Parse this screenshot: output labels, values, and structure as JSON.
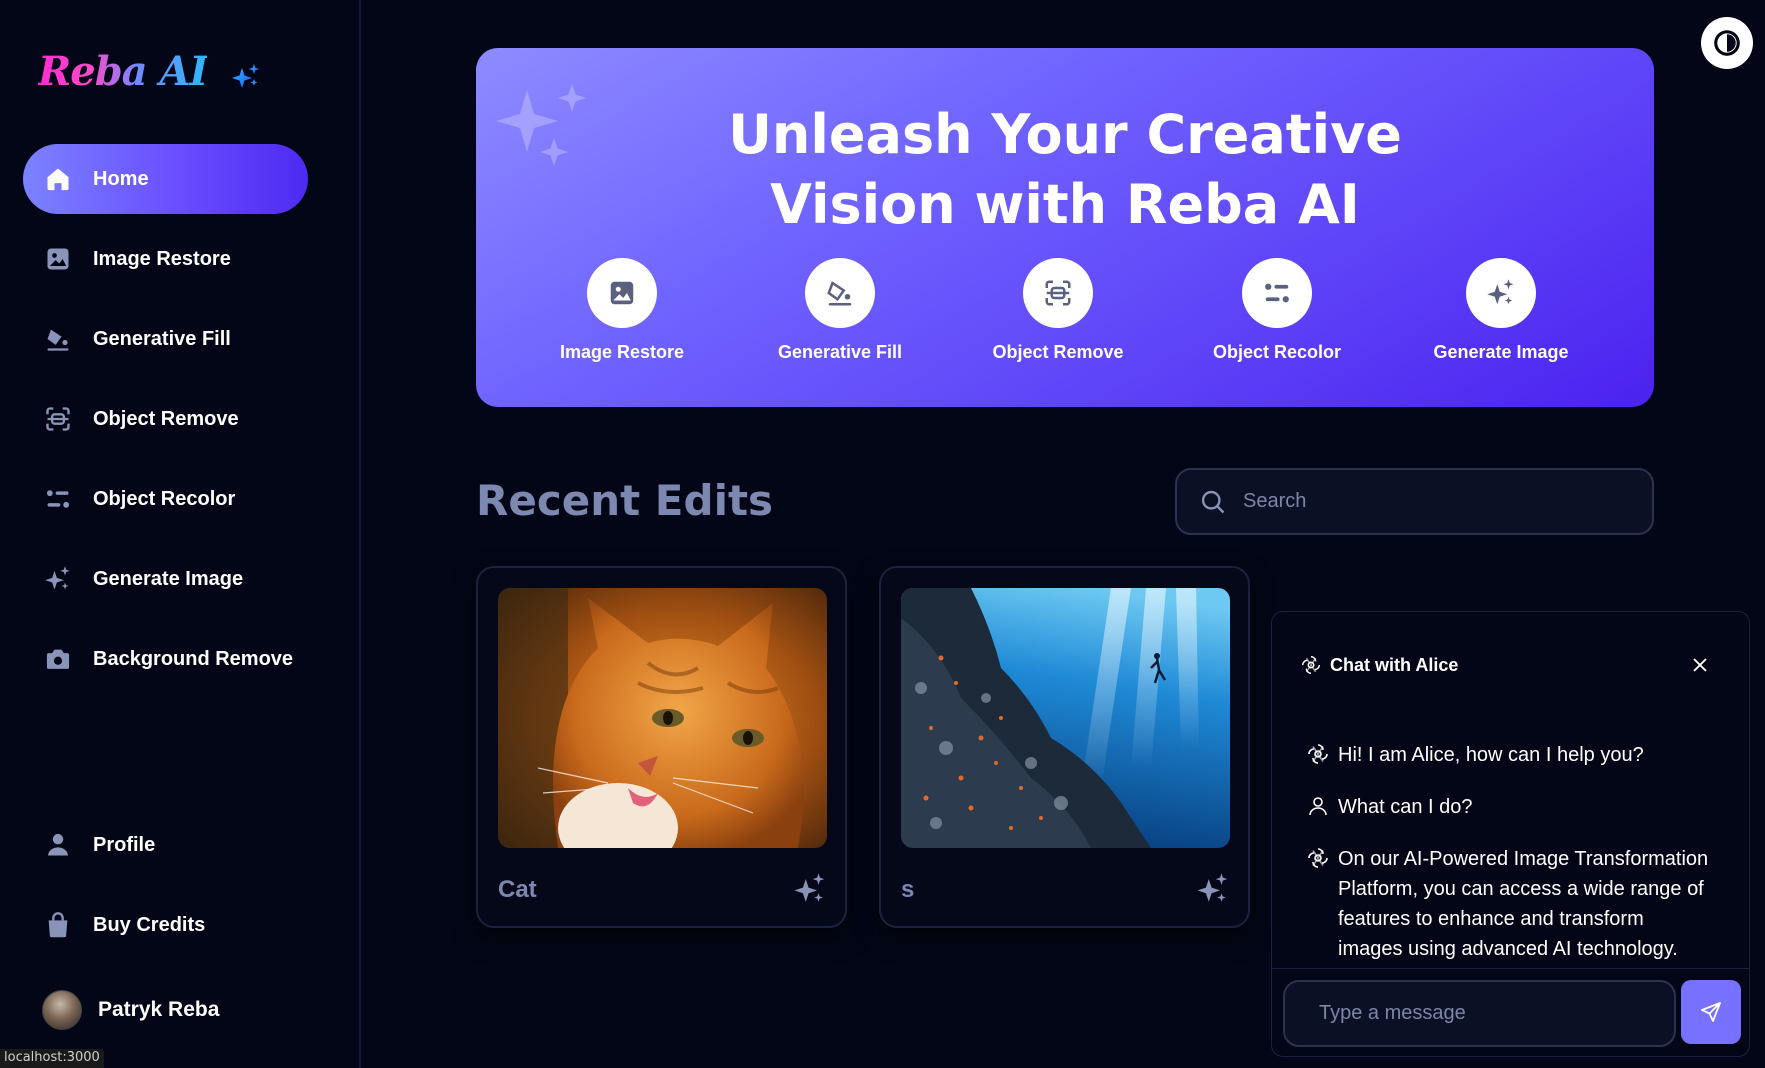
{
  "app": {
    "logo_text": "Reba AI",
    "brand_gradient": [
      "#ff2bd1",
      "#2fb7ff"
    ],
    "accent": "#6a4dff"
  },
  "sidebar": {
    "items": [
      {
        "label": "Home",
        "icon": "home-icon",
        "active": true
      },
      {
        "label": "Image Restore",
        "icon": "image-icon"
      },
      {
        "label": "Generative Fill",
        "icon": "paint-bucket-icon"
      },
      {
        "label": "Object Remove",
        "icon": "scan-icon"
      },
      {
        "label": "Object Recolor",
        "icon": "recolor-icon"
      },
      {
        "label": "Generate Image",
        "icon": "sparkles-icon"
      },
      {
        "label": "Background Remove",
        "icon": "camera-icon"
      }
    ],
    "bottom_items": [
      {
        "label": "Profile",
        "icon": "user-icon"
      },
      {
        "label": "Buy Credits",
        "icon": "bag-icon"
      }
    ],
    "user_name": "Patryk Reba"
  },
  "hero": {
    "title_line1": "Unleash Your Creative",
    "title_line2": "Vision with Reba AI",
    "tools": [
      {
        "label": "Image Restore",
        "icon": "image-icon"
      },
      {
        "label": "Generative Fill",
        "icon": "paint-bucket-icon"
      },
      {
        "label": "Object Remove",
        "icon": "scan-icon"
      },
      {
        "label": "Object Recolor",
        "icon": "recolor-icon"
      },
      {
        "label": "Generate Image",
        "icon": "sparkles-icon"
      }
    ]
  },
  "recent": {
    "title": "Recent Edits",
    "search_placeholder": "Search",
    "cards": [
      {
        "title": "Cat"
      },
      {
        "title": "s"
      }
    ]
  },
  "chat": {
    "title": "Chat with Alice",
    "messages": [
      {
        "role": "assistant",
        "text": "Hi! I am Alice, how can I help you?"
      },
      {
        "role": "user",
        "text": "What can I do?"
      },
      {
        "role": "assistant",
        "text": "On our AI-Powered Image Transformation Platform, you can access a wide range of features to enhance and transform images using advanced AI technology. Here are"
      }
    ],
    "input_placeholder": "Type a message"
  },
  "status_bar": {
    "url": "localhost:3000"
  }
}
